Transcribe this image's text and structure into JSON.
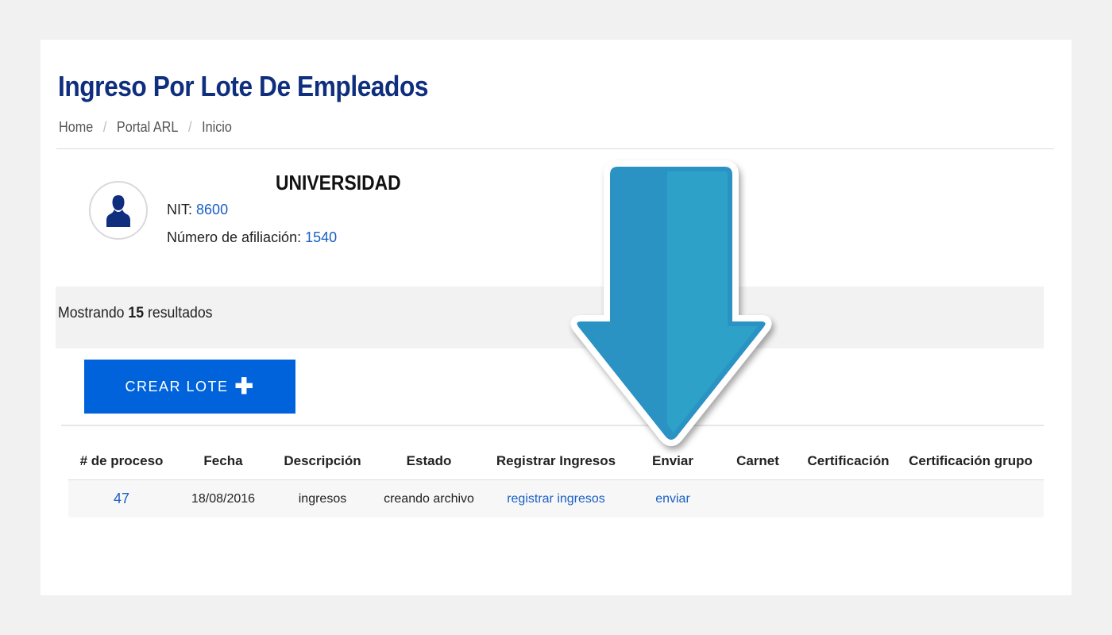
{
  "header": {
    "title": "Ingreso Por Lote De Empleados",
    "breadcrumb": [
      "Home",
      "Portal ARL",
      "Inicio"
    ]
  },
  "profile": {
    "avatar_icon": "user-icon",
    "company_name": "UNIVERSIDAD",
    "nit_label": "NIT:",
    "nit_value": "8600",
    "afiliacion_label": "Número de afiliación:",
    "afiliacion_value": "1540"
  },
  "results": {
    "prefix": "Mostrando",
    "count": "15",
    "suffix": "resultados"
  },
  "actions": {
    "create_label": "CREAR LOTE",
    "create_icon": "plus-icon"
  },
  "table": {
    "headers": [
      "# de proceso",
      "Fecha",
      "Descripción",
      "Estado",
      "Registrar Ingresos",
      "Enviar",
      "Carnet",
      "Certificación",
      "Certificación grupo"
    ],
    "rows": [
      {
        "proceso": "47",
        "fecha": "18/08/2016",
        "descripcion": "ingresos",
        "estado": "creando archivo",
        "registrar": "registrar ingresos",
        "enviar": "enviar",
        "carnet": "",
        "certificacion": "",
        "certificacion_grupo": ""
      }
    ]
  },
  "annotation": {
    "icon": "down-arrow-icon",
    "color": "#2a93c4"
  },
  "colors": {
    "title": "#0f2f7e",
    "link": "#1a5fc4",
    "button": "#0063db"
  }
}
